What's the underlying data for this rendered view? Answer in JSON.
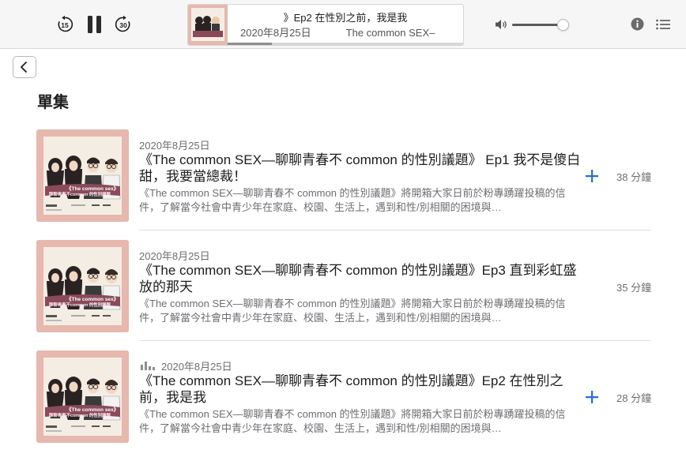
{
  "player": {
    "skip_back_label": "15",
    "skip_forward_label": "30",
    "now_playing_title": "》Ep2 在性別之前，我是我",
    "now_playing_date": "2020年8月25日",
    "now_playing_show": "The common SEX–",
    "progress": 0.19,
    "volume": 0.9
  },
  "section_title": "單集",
  "colors": {
    "accent": "#1f6fd6",
    "art_bg": "#e6b8ae"
  },
  "episodes": [
    {
      "date": "2020年8月25日",
      "title": "《The common SEX—聊聊青春不 common 的性別議題》 Ep1 我不是傻白甜，我要當總裁！",
      "description": "《The common SEX—聊聊青春不 common 的性別議題》將開箱大家日前於粉專踴躍投稿的信件，了解當今社會中青少年在家庭、校園、生活上，遇到和性/別相關的困境與…",
      "duration": "38 分鐘",
      "has_add": true,
      "playing": false
    },
    {
      "date": "2020年8月25日",
      "title": "《The common SEX—聊聊青春不 common 的性別議題》Ep3 直到彩虹盛放的那天",
      "description": "《The common SEX—聊聊青春不 common 的性別議題》將開箱大家日前於粉專踴躍投稿的信件，了解當今社會中青少年在家庭、校園、生活上，遇到和性/別相關的困境與…",
      "duration": "35 分鐘",
      "has_add": false,
      "playing": false
    },
    {
      "date": "2020年8月25日",
      "title": "《The common SEX—聊聊青春不 common 的性別議題》Ep2 在性別之前，我是我",
      "description": "《The common SEX—聊聊青春不 common 的性別議題》將開箱大家日前於粉專踴躍投稿的信件，了解當今社會中青少年在家庭、校園、生活上，遇到和性/別相關的困境與…",
      "duration": "28 分鐘",
      "has_add": true,
      "playing": true
    }
  ],
  "artwork": {
    "badge_line1": "《The common sex》",
    "badge_line2": "聊聊青春不common 的性別議題"
  }
}
